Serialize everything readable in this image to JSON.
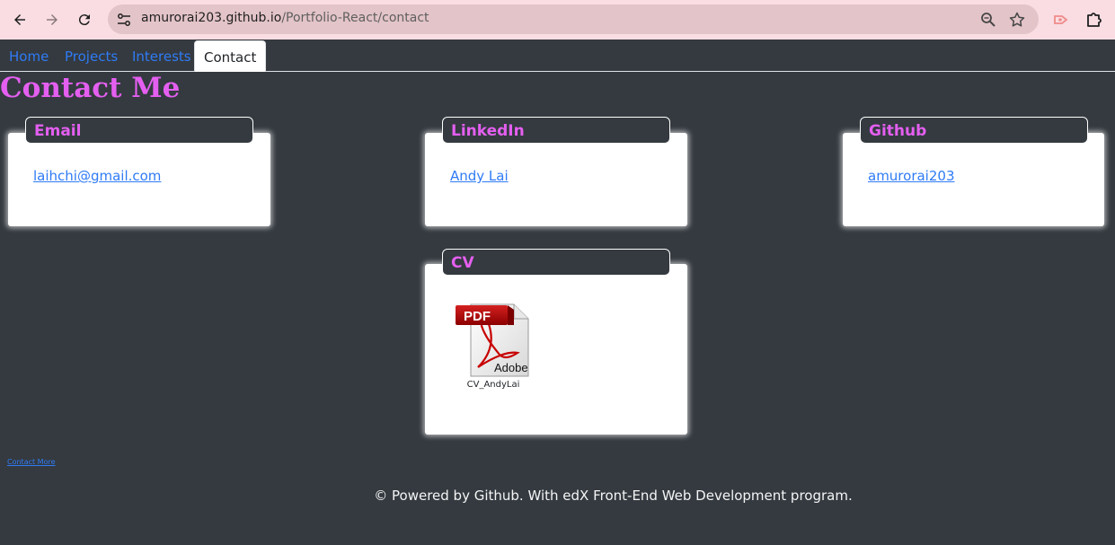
{
  "browser": {
    "url_host": "amurorai203.github.io",
    "url_path": "/Portfolio-React/contact",
    "icons": [
      "back-icon",
      "forward-icon",
      "reload-icon",
      "site-info-icon",
      "zoom-icon",
      "bookmark-star-icon",
      "extension-puzzle-icon"
    ]
  },
  "nav": {
    "items": [
      {
        "label": "Home"
      },
      {
        "label": "Projects"
      },
      {
        "label": "Interests"
      },
      {
        "label": "Contact"
      }
    ],
    "active": "Contact"
  },
  "page": {
    "title": "Contact Me"
  },
  "cards": {
    "email": {
      "title": "Email",
      "link": "laihchi@gmail.com"
    },
    "linkedin": {
      "title": "LinkedIn",
      "link": "Andy Lai"
    },
    "github": {
      "title": "Github",
      "link": "amurorai203"
    },
    "cv": {
      "title": "CV",
      "file_label": "CV_AndyLai",
      "pdf_badge": "PDF",
      "pdf_brand": "Adobe"
    }
  },
  "contact_more": "Contact More",
  "footer": "© Powered by Github. With edX Front-End Web Development program.",
  "colors": {
    "background": "#343a40",
    "accent": "#e45ff0",
    "link": "#2f7bf5",
    "chrome": "#f9dde2"
  }
}
